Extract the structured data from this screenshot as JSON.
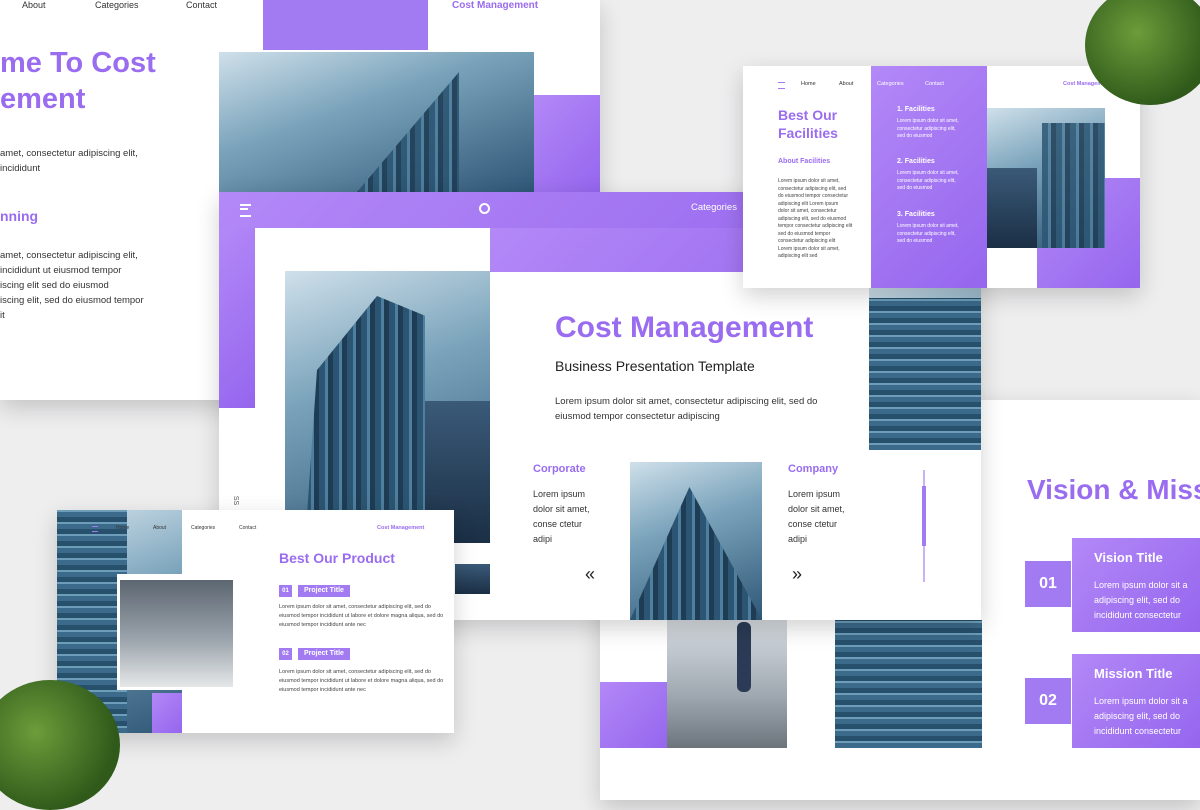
{
  "slide_left": {
    "nav": [
      "About",
      "Categories",
      "Contact"
    ],
    "brand": "Cost Management",
    "heading_line1": "me To Cost",
    "heading_line2": "ement",
    "text1_line1": "amet, consectetur adipiscing elit,",
    "text1_line2": "incididunt",
    "subheading": "nning",
    "text2_lines": [
      "amet, consectetur adipiscing elit,",
      "incididunt ut eiusmod tempor",
      "iscing elit sed do eiusmod",
      "iscing elit, sed do eiusmod tempor",
      "it"
    ]
  },
  "slide_main": {
    "nav_item": "Categories",
    "title": "Cost Management",
    "subtitle": "Business Presentation Template",
    "desc_line1": "Lorem ipsum dolor sit amet, consectetur adipiscing elit, sed do",
    "desc_line2": "eiusmod tempor consectetur adipiscing",
    "side_text": "SS",
    "corporate_title": "Corporate",
    "corporate_lines": [
      "Lorem ipsum",
      "dolor sit amet,",
      "conse ctetur",
      "adipi"
    ],
    "company_title": "Company",
    "company_lines": [
      "Lorem ipsum",
      "dolor sit amet,",
      "conse ctetur",
      "adipi"
    ],
    "prev_glyph": "«",
    "next_glyph": "»"
  },
  "slide_facilities": {
    "nav": [
      "Home",
      "About",
      "Categories",
      "Contact"
    ],
    "brand": "Cost Management",
    "title_line1": "Best Our",
    "title_line2": "Facilities",
    "about_label": "About Facilities",
    "about_lines": [
      "Lorem ipsum dolor sit amet,",
      "consectetur adipiscing elit, sed",
      "do eiusmod tempor consectetur",
      "adipiscing elit Lorem ipsum",
      "dolor sit amet, consectetur",
      "adipiscing elit, sed do eiusmod",
      "tempor consectetur adipiscing elit",
      "sed do eiusmod tempor",
      "consectetur adipiscing elit",
      "Lorem ipsum dolor sit amet,",
      "adipiscing elit sed"
    ],
    "items": [
      {
        "label": "1. Facilities",
        "lines": [
          "Lorem ipsum dolor sit amet,",
          "consectetur adipiscing elit,",
          "sed do eiusmod"
        ]
      },
      {
        "label": "2. Facilities",
        "lines": [
          "Lorem ipsum dolor sit amet,",
          "consectetur adipiscing elit,",
          "sed do eiusmod"
        ]
      },
      {
        "label": "3. Facilities",
        "lines": [
          "Lorem ipsum dolor sit amet,",
          "consectetur adipiscing elit,",
          "sed do eiusmod"
        ]
      }
    ]
  },
  "slide_product": {
    "nav": [
      "Home",
      "About",
      "Categories",
      "Contact"
    ],
    "brand": "Cost Management",
    "title": "Best Our Product",
    "items": [
      {
        "num": "01",
        "label": "Project Title",
        "lines": [
          "Lorem ipsum dolor sit amet, consectetur adipiscing elit, sed do",
          "eiusmod tempor incididunt ut labore et dolore magna aliqua, sed do",
          "eiusmod tempor incididunt ante nec"
        ]
      },
      {
        "num": "02",
        "label": "Project Title",
        "lines": [
          "Lorem ipsum dolor sit amet, consectetur adipiscing elit, sed do",
          "eiusmod tempor incididunt ut labore et dolore magna aliqua, sed do",
          "eiusmod tempor incididunt ante nec"
        ]
      }
    ]
  },
  "slide_vision": {
    "title": "Vision & Miss",
    "items": [
      {
        "num": "01",
        "title": "Vision Title",
        "lines": [
          "Lorem ipsum dolor sit a",
          "adipiscing elit, sed do",
          "incididunt consectetur"
        ]
      },
      {
        "num": "02",
        "title": "Mission Title",
        "lines": [
          "Lorem ipsum dolor sit a",
          "adipiscing elit, sed do",
          "incididunt consectetur"
        ]
      }
    ]
  }
}
